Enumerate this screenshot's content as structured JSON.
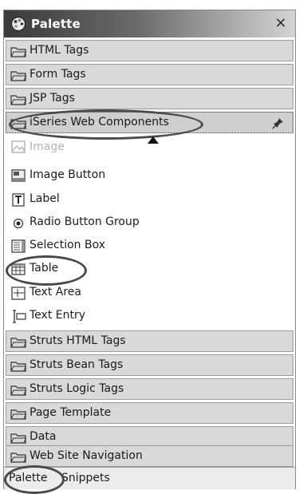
{
  "title": "Palette",
  "close_glyph": "×",
  "drawers_top": [
    {
      "label": "HTML Tags",
      "icon": "folder-icon"
    },
    {
      "label": "Form Tags",
      "icon": "folder-icon"
    },
    {
      "label": "JSP Tags",
      "icon": "folder-icon"
    }
  ],
  "open_drawer": {
    "label": "iSeries Web Components",
    "icon": "folder-icon",
    "pin": "pin-icon"
  },
  "tools": [
    {
      "label": "Image",
      "icon": "image-icon"
    },
    {
      "label": "Image Button",
      "icon": "image-button-icon"
    },
    {
      "label": "Label",
      "icon": "label-icon"
    },
    {
      "label": "Radio Button Group",
      "icon": "radio-icon"
    },
    {
      "label": "Selection Box",
      "icon": "selection-box-icon"
    },
    {
      "label": "Table",
      "icon": "table-icon"
    },
    {
      "label": "Text Area",
      "icon": "text-area-icon"
    },
    {
      "label": "Text Entry",
      "icon": "text-entry-icon"
    }
  ],
  "drawers_bottom": [
    {
      "label": "Struts HTML Tags",
      "icon": "folder-icon"
    },
    {
      "label": "Struts Bean Tags",
      "icon": "folder-icon"
    },
    {
      "label": "Struts Logic Tags",
      "icon": "folder-icon"
    },
    {
      "label": "Page Template",
      "icon": "folder-icon"
    },
    {
      "label": "Data",
      "icon": "folder-icon"
    },
    {
      "label": "Web Site Navigation",
      "icon": "folder-icon"
    }
  ],
  "tabs": [
    {
      "label": "Palette",
      "active": true
    },
    {
      "label": "Snippets",
      "active": false
    }
  ]
}
